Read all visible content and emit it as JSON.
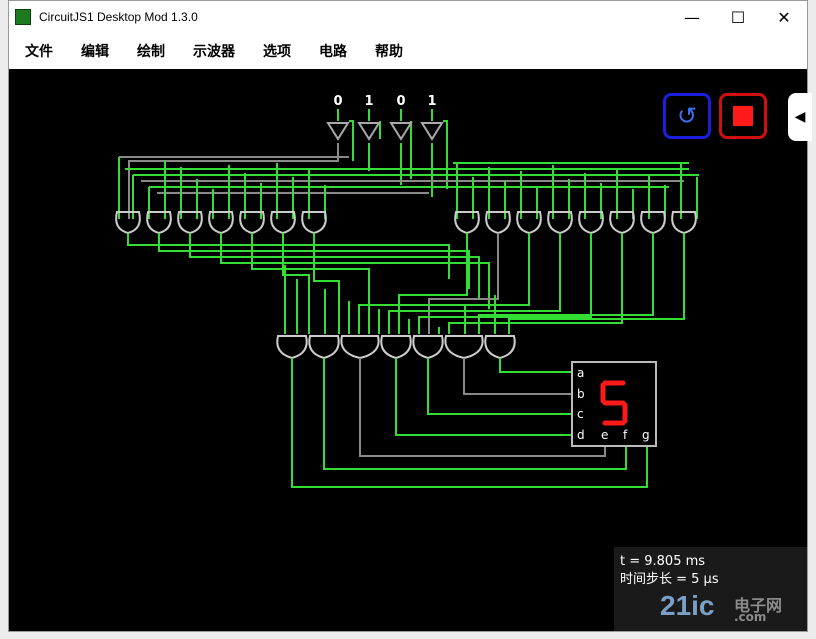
{
  "window": {
    "title": "CircuitJS1 Desktop Mod 1.3.0",
    "minimize_label": "—",
    "maximize_label": "☐",
    "close_label": "✕"
  },
  "menu": {
    "items": [
      "文件",
      "编辑",
      "绘制",
      "示波器",
      "选项",
      "电路",
      "帮助"
    ]
  },
  "inputs": {
    "labels": [
      "0",
      "1",
      "0",
      "1"
    ]
  },
  "display": {
    "pins_left": [
      "a",
      "b",
      "c",
      "d"
    ],
    "pins_bottom": [
      "e",
      "f",
      "g"
    ],
    "digit": "5"
  },
  "status": {
    "time_label": "t = 9.805 ms",
    "step_label": "时间步长 = 5 μs"
  },
  "controls": {
    "reset_glyph": "↺",
    "collapse_glyph": "◀"
  },
  "watermark": {
    "brand": "21ic",
    "cn": "电子网",
    "com": ".com"
  },
  "colors": {
    "wire_active": "#33dd33",
    "wire_inactive": "#8a8a8a",
    "segment_on": "#ff1a1a",
    "reset_border": "#1d1ddc",
    "stop_border": "#d01010"
  }
}
